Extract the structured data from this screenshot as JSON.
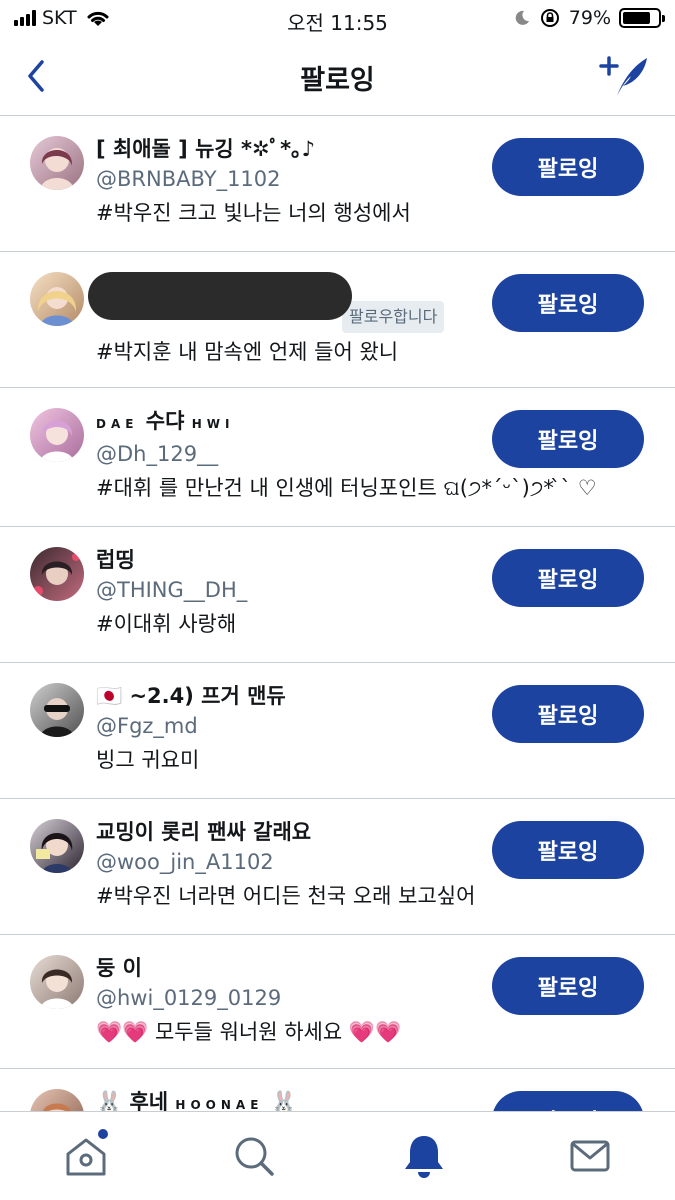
{
  "status_bar": {
    "carrier": "SKT",
    "time": "오전 11:55",
    "battery": "79%",
    "battery_level": 0.79
  },
  "header": {
    "title": "팔로잉"
  },
  "follow_button_label": "팔로잉",
  "users": [
    {
      "name": "[ 최애돌 ] 뉴깅 *✲ﾟ*｡♪",
      "handle": "@BRNBABY_1102",
      "bio": "#박우진 크고 빛나는 너의 행성에서",
      "avatar_color": "#b99aa8"
    },
    {
      "name": "",
      "handle": "",
      "follows_you": "팔로우합니다",
      "bio": "#박지훈 내 맘속엔 언제 들어 왔니",
      "avatar_color": "#d9b48a"
    },
    {
      "name_small_left": "DAE",
      "name": "수댜",
      "name_small_right": "HWI",
      "handle": "@Dh_129__",
      "bio": "#대휘 를 만난건 내 인생에 터닝포인트 ଘ(੭*ˊᵕˋ)੭* ̀ˋ ♡",
      "avatar_color": "#c98fb4"
    },
    {
      "name": "럽띵",
      "handle": "@THING__DH_",
      "bio": "#이대휘 사랑해",
      "avatar_color": "#7a5a64"
    },
    {
      "name": "🇯🇵 ~2.4) 프거 맨듀",
      "handle": "@Fgz_md",
      "bio": "빙그 귀요미",
      "avatar_color": "#6b6b6b"
    },
    {
      "name": "교밍이 롯리 팬싸 갈래요",
      "handle": "@woo_jin_A1102",
      "bio": "#박우진 너라면 어디든 천국 오래 보고싶어",
      "avatar_color": "#3a3040"
    },
    {
      "name": "둥 이",
      "handle": "@hwi_0129_0129",
      "bio": "💗💗 모두들 워너원 하세요 💗💗",
      "avatar_color": "#c4b0a8"
    },
    {
      "name_prefix": "🐰 후네",
      "name_small_right": "HOONAE",
      "name_suffix": "🐰",
      "avatar_color": "#a87e6a"
    }
  ],
  "tabs": [
    {
      "icon": "home-icon"
    },
    {
      "icon": "search-icon"
    },
    {
      "icon": "notifications-icon"
    },
    {
      "icon": "messages-icon"
    }
  ],
  "colors": {
    "accent": "#1d43a0",
    "text": "#14171a",
    "secondary_text": "#5b6b7b",
    "divider": "#c9ced3"
  }
}
